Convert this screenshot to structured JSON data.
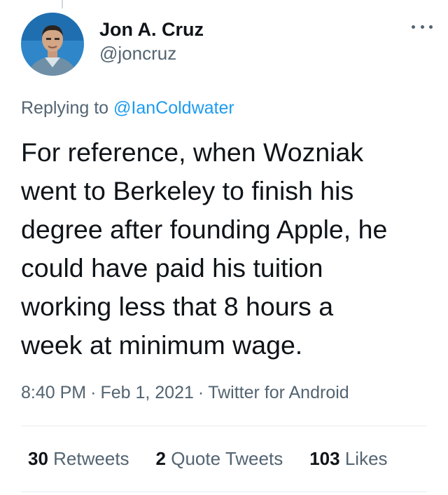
{
  "author": {
    "display_name": "Jon A. Cruz",
    "handle": "@joncruz",
    "avatar_icon": "profile-photo"
  },
  "reply": {
    "prefix": "Replying to",
    "mention": "@IanColdwater"
  },
  "tweet": {
    "lines": [
      "For reference, when Wozniak",
      "went to Berkeley to finish his",
      "degree after founding Apple, he",
      "could have paid his tuition",
      "working less that 8 hours a",
      "week at minimum wage."
    ]
  },
  "meta": {
    "time": "8:40 PM",
    "separator": "·",
    "date": "Feb 1, 2021",
    "source": "Twitter for Android"
  },
  "stats": {
    "retweets_count": "30",
    "retweets_label": "Retweets",
    "quotes_count": "2",
    "quotes_label": "Quote Tweets",
    "likes_count": "103",
    "likes_label": "Likes"
  },
  "colors": {
    "link": "#1d9bf0",
    "secondary_text": "#536471",
    "primary_text": "#0f1419",
    "divider": "#e6ecf0"
  }
}
